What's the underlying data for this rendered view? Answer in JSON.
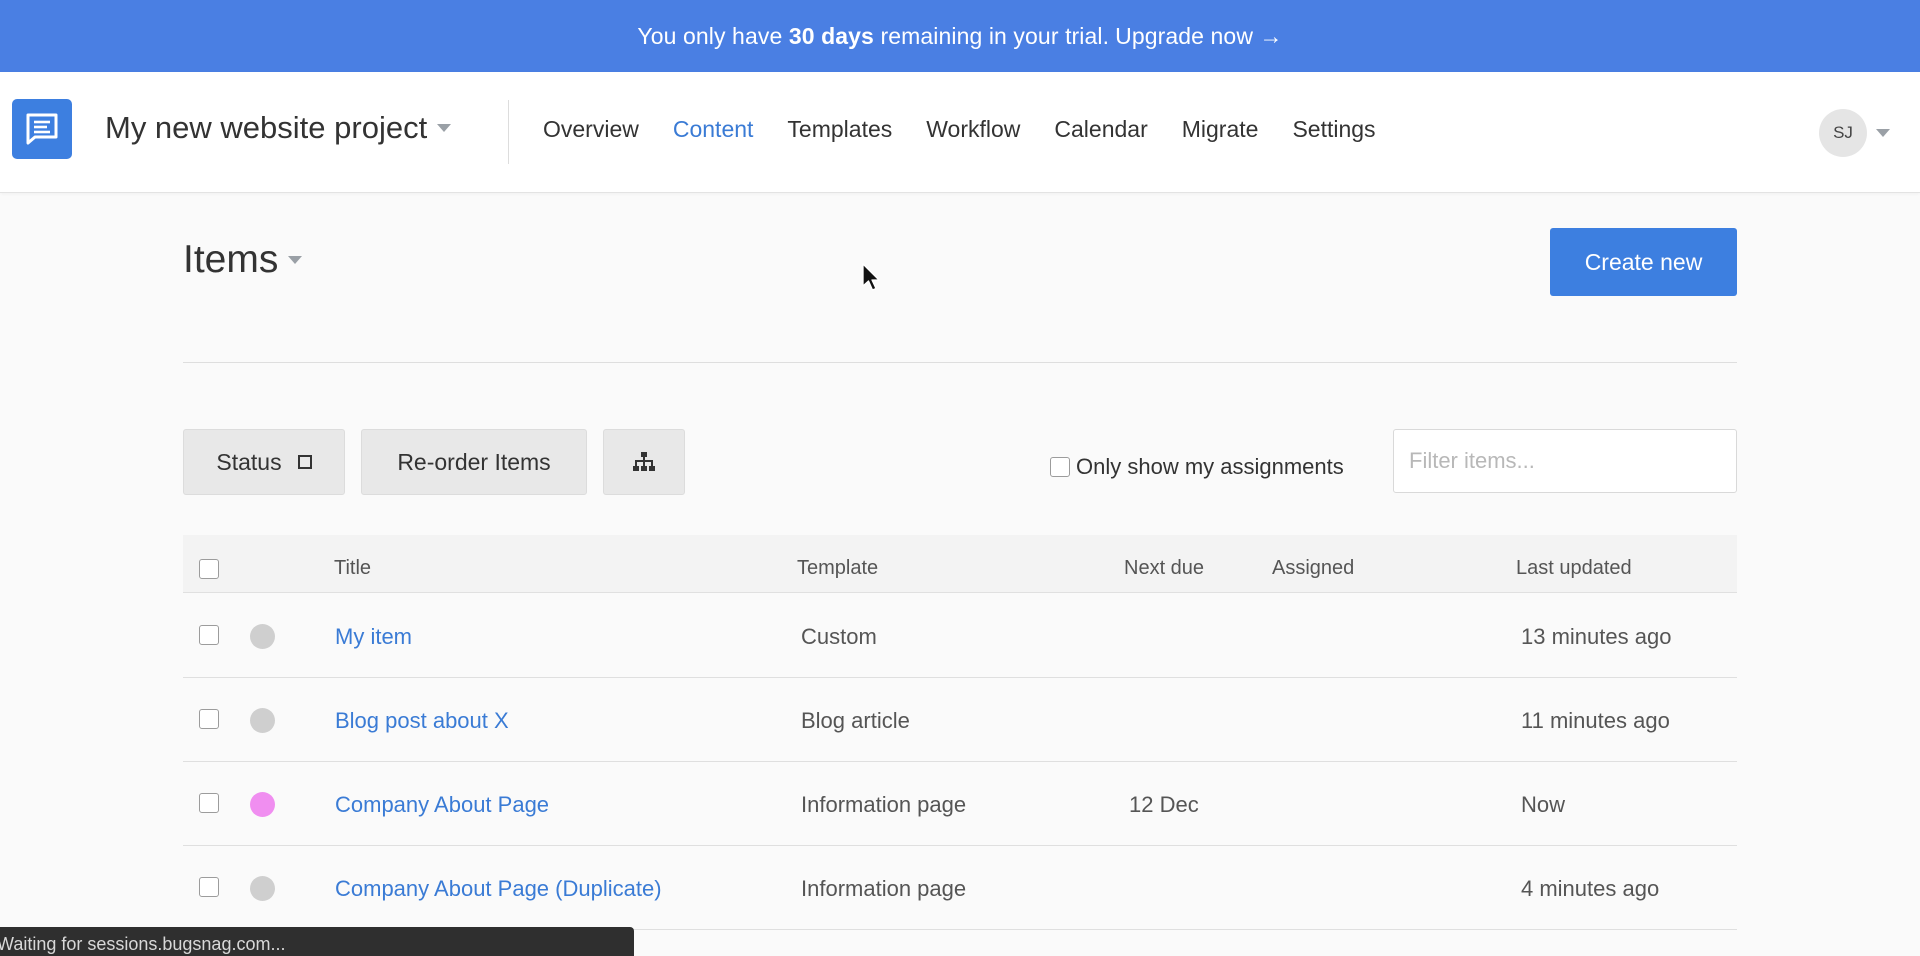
{
  "banner": {
    "prefix": "You only have",
    "days": "30 days",
    "suffix": "remaining in your trial.",
    "upgrade": "Upgrade now →",
    "color": "#4a7fe3"
  },
  "header": {
    "logo_icon": "document-chat-icon",
    "project_title": "My new website project",
    "nav": [
      {
        "label": "Overview",
        "active": false
      },
      {
        "label": "Content",
        "active": true
      },
      {
        "label": "Templates",
        "active": false
      },
      {
        "label": "Workflow",
        "active": false
      },
      {
        "label": "Calendar",
        "active": false
      },
      {
        "label": "Migrate",
        "active": false
      },
      {
        "label": "Settings",
        "active": false
      }
    ],
    "avatar_initials": "SJ"
  },
  "page": {
    "heading": "Items",
    "create_label": "Create new",
    "accent_color": "#3d7fe0"
  },
  "toolbar": {
    "status_label": "Status",
    "reorder_label": "Re-order Items",
    "hierarchy_icon": "sitemap-icon",
    "only_mine_label": "Only show my assignments",
    "filter_placeholder": "Filter items..."
  },
  "table": {
    "columns": {
      "title": "Title",
      "template": "Template",
      "next_due": "Next due",
      "assigned": "Assigned",
      "last_updated": "Last updated"
    },
    "rows": [
      {
        "status_color": "#cfcfcf",
        "title": "My item",
        "template": "Custom",
        "next_due": "",
        "assigned": "",
        "last_updated": "13 minutes ago"
      },
      {
        "status_color": "#cfcfcf",
        "title": "Blog post about X",
        "template": "Blog article",
        "next_due": "",
        "assigned": "",
        "last_updated": "11 minutes ago"
      },
      {
        "status_color": "#f08ef0",
        "title": "Company About Page",
        "template": "Information page",
        "next_due": "12 Dec",
        "assigned": "",
        "last_updated": "Now"
      },
      {
        "status_color": "#cfcfcf",
        "title": "Company About Page (Duplicate)",
        "template": "Information page",
        "next_due": "",
        "assigned": "",
        "last_updated": "4 minutes ago"
      }
    ]
  },
  "status_bar": {
    "text": "Waiting for sessions.bugsnag.com..."
  }
}
